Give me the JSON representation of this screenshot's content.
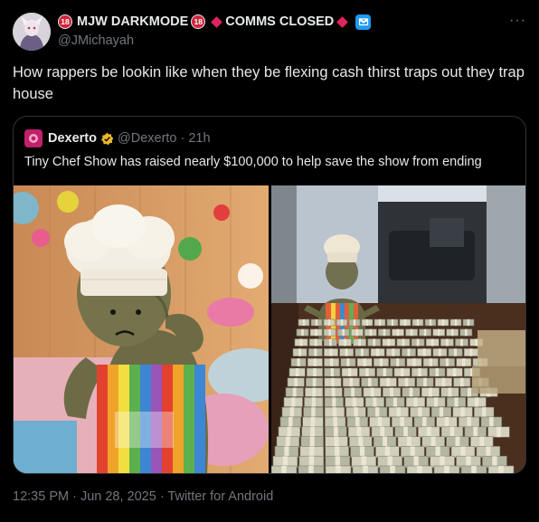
{
  "tweet": {
    "author": {
      "badge_left": "18",
      "name_part1": "MJW DARKMODE",
      "badge_right": "18",
      "name_part2": "COMMS CLOSED",
      "handle": "@JMichayah"
    },
    "more_label": "···",
    "text": "How rappers be lookin like when they be flexing cash thirst traps out they trap house",
    "quoted": {
      "name": "Dexerto",
      "handle": "@Dexerto",
      "separator": "·",
      "time": "21h",
      "text": "Tiny Chef Show has raised nearly $100,000 to help save the show from ending",
      "media": [
        {
          "icon": "tiny-chef-worried-image"
        },
        {
          "icon": "tiny-chef-cash-image"
        }
      ]
    },
    "footer": "12:35 PM · Jun 28, 2025 · Twitter for Android"
  },
  "colors": {
    "background": "#000000",
    "text": "#e7e9ea",
    "muted": "#71767b",
    "border": "#2f3336",
    "verified_blue": "#1d9bf0",
    "verified_gold": "#e8b829",
    "diamond_red": "#e0245e"
  }
}
